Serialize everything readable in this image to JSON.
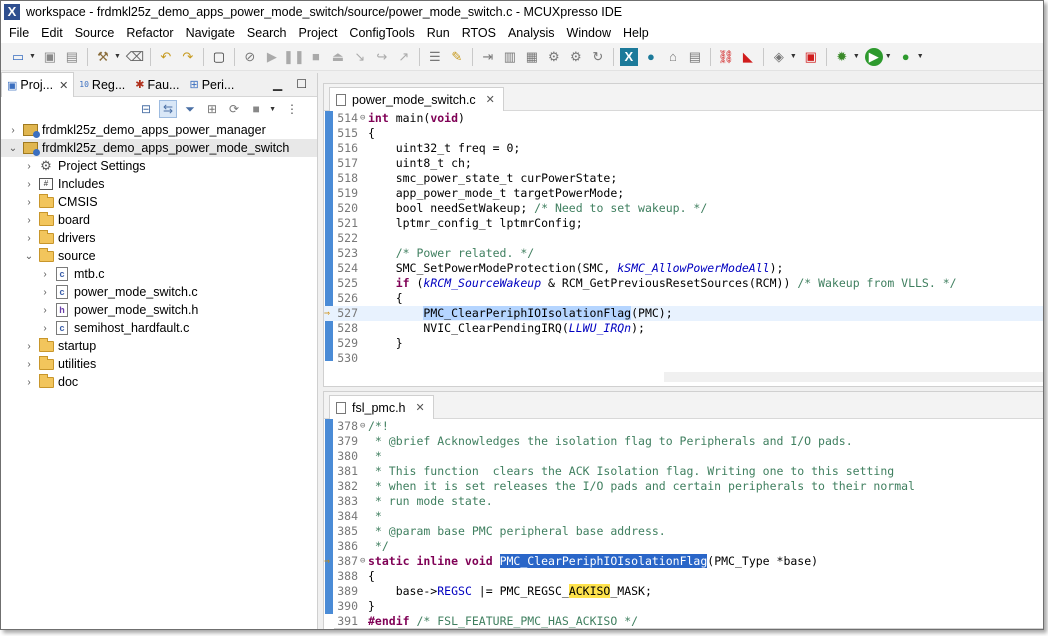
{
  "window": {
    "title": "workspace - frdmkl25z_demo_apps_power_mode_switch/source/power_mode_switch.c - MCUXpresso IDE"
  },
  "menu": [
    "File",
    "Edit",
    "Source",
    "Refactor",
    "Navigate",
    "Search",
    "Project",
    "ConfigTools",
    "Run",
    "RTOS",
    "Analysis",
    "Window",
    "Help"
  ],
  "left_panel": {
    "tabs": [
      {
        "label": "Proj...",
        "icon": "project-explorer-icon"
      },
      {
        "label": "Reg...",
        "icon": "registers-icon"
      },
      {
        "label": "Fau...",
        "icon": "fault-analyzer-icon"
      },
      {
        "label": "Peri...",
        "icon": "peripherals-icon"
      }
    ],
    "tree": [
      {
        "label": "frdmkl25z_demo_apps_power_manager",
        "type": "project",
        "state": "collapsed",
        "depth": 0
      },
      {
        "label": "frdmkl25z_demo_apps_power_mode_switch",
        "type": "project",
        "state": "expanded",
        "depth": 0
      },
      {
        "label": "Project Settings",
        "type": "settings",
        "state": "collapsed",
        "depth": 1
      },
      {
        "label": "Includes",
        "type": "includes",
        "state": "collapsed",
        "depth": 1
      },
      {
        "label": "CMSIS",
        "type": "folder",
        "state": "collapsed",
        "depth": 1
      },
      {
        "label": "board",
        "type": "folder",
        "state": "collapsed",
        "depth": 1
      },
      {
        "label": "drivers",
        "type": "folder",
        "state": "collapsed",
        "depth": 1
      },
      {
        "label": "source",
        "type": "folder",
        "state": "expanded",
        "depth": 1
      },
      {
        "label": "mtb.c",
        "type": "cfile",
        "state": "collapsed",
        "depth": 2
      },
      {
        "label": "power_mode_switch.c",
        "type": "cfile",
        "state": "collapsed",
        "depth": 2
      },
      {
        "label": "power_mode_switch.h",
        "type": "hfile",
        "state": "collapsed",
        "depth": 2
      },
      {
        "label": "semihost_hardfault.c",
        "type": "cfile",
        "state": "collapsed",
        "depth": 2
      },
      {
        "label": "startup",
        "type": "folder",
        "state": "collapsed",
        "depth": 1
      },
      {
        "label": "utilities",
        "type": "folder",
        "state": "collapsed",
        "depth": 1
      },
      {
        "label": "doc",
        "type": "folder",
        "state": "collapsed",
        "depth": 1
      }
    ]
  },
  "editor1": {
    "tab": "power_mode_switch.c",
    "lines": [
      {
        "n": "514",
        "fold": "⊖",
        "html": "<span class=\"kw\">int</span> main(<span class=\"kw\">void</span>)"
      },
      {
        "n": "515",
        "html": "{"
      },
      {
        "n": "516",
        "html": "    uint32_t freq = 0;"
      },
      {
        "n": "517",
        "html": "    uint8_t ch;"
      },
      {
        "n": "518",
        "html": "    smc_power_state_t curPowerState;"
      },
      {
        "n": "519",
        "html": "    app_power_mode_t targetPowerMode;"
      },
      {
        "n": "520",
        "html": "    bool needSetWakeup; <span class=\"cm\">/* Need to set wakeup. */</span>"
      },
      {
        "n": "521",
        "html": "    lptmr_config_t lptmrConfig;"
      },
      {
        "n": "522",
        "html": ""
      },
      {
        "n": "523",
        "html": "    <span class=\"cm\">/* Power related. */</span>"
      },
      {
        "n": "524",
        "html": "    SMC_SetPowerModeProtection(SMC, <span class=\"it\">kSMC_AllowPowerModeAll</span>);"
      },
      {
        "n": "525",
        "html": "    <span class=\"kw\">if</span> (<span class=\"it\">kRCM_SourceWakeup</span> &amp; RCM_GetPreviousResetSources(RCM)) <span class=\"cm\">/* Wakeup from VLLS. */</span>"
      },
      {
        "n": "526",
        "html": "    {"
      },
      {
        "n": "527",
        "cur": true,
        "html": "        <span class=\"hl\">PMC_ClearPeriphIOIsolationFlag</span>(PMC);"
      },
      {
        "n": "528",
        "html": "        NVIC_ClearPendingIRQ(<span class=\"it\">LLWU_IRQn</span>);"
      },
      {
        "n": "529",
        "html": "    }"
      },
      {
        "n": "530",
        "html": ""
      }
    ]
  },
  "editor2": {
    "tab": "fsl_pmc.h",
    "lines": [
      {
        "n": "378",
        "fold": "⊖",
        "html": "<span class=\"cm\">/*!</span>"
      },
      {
        "n": "379",
        "html": "<span class=\"cm\"> * @brief Acknowledges the isolation flag to Peripherals and I/O pads.</span>"
      },
      {
        "n": "380",
        "html": "<span class=\"cm\"> *</span>"
      },
      {
        "n": "381",
        "html": "<span class=\"cm\"> * This function  clears the ACK Isolation flag. Writing one to this setting</span>"
      },
      {
        "n": "382",
        "html": "<span class=\"cm\"> * when it is set releases the I/O pads and certain peripherals to their normal</span>"
      },
      {
        "n": "383",
        "html": "<span class=\"cm\"> * run mode state.</span>"
      },
      {
        "n": "384",
        "html": "<span class=\"cm\"> *</span>"
      },
      {
        "n": "385",
        "html": "<span class=\"cm\"> * @param base PMC peripheral base address.</span>"
      },
      {
        "n": "386",
        "html": "<span class=\"cm\"> */</span>"
      },
      {
        "n": "387",
        "fold": "⊖",
        "html": "<span class=\"kw\">static inline void</span> <span class=\"hl2\">PMC_ClearPeriphIOIsolationFlag</span>(PMC_Type *base)"
      },
      {
        "n": "388",
        "html": "{"
      },
      {
        "n": "389",
        "html": "    base-&gt;<span class=\"fld\">REGSC</span> |= PMC_REGSC_<span class=\"yel\">ACKISO</span>_MASK;"
      },
      {
        "n": "390",
        "html": "}"
      },
      {
        "n": "391",
        "html": "<span class=\"kw\">#endif</span> <span class=\"cm\">/* FSL_FEATURE_PMC_HAS_ACKISO */</span>"
      }
    ]
  }
}
